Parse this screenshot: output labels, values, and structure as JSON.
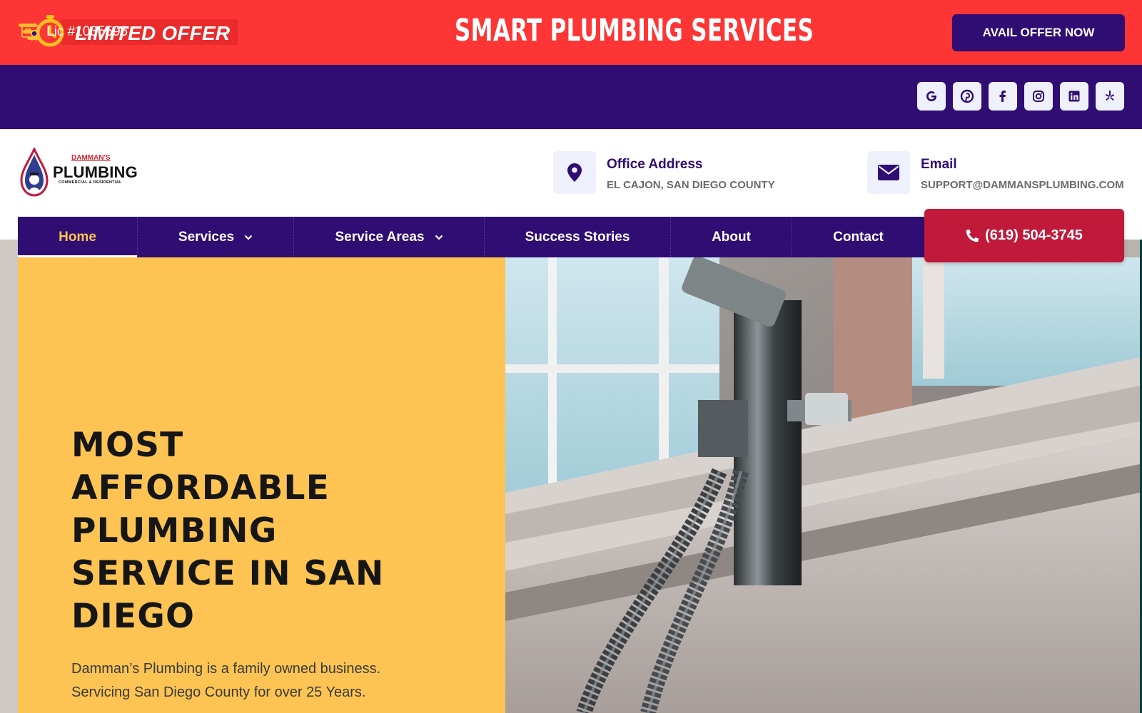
{
  "promo": {
    "badge_label": "LIMITED OFFER",
    "title": "SMART PLUMBING SERVICES",
    "cta_label": "AVAIL OFFER NOW",
    "background_color": "#fd3535"
  },
  "license_bar": {
    "license_text": "Lic #1035596",
    "social_icons": [
      "google-icon",
      "pinterest-icon",
      "facebook-icon",
      "instagram-icon",
      "linkedin-icon",
      "yelp-icon"
    ],
    "background_color": "#2f0d72"
  },
  "header": {
    "logo": {
      "top_text": "DAMMAN'S",
      "main_text": "PLUMBING",
      "sub_text": "COMMERCIAL & RESIDENTIAL"
    },
    "office": {
      "title": "Office Address",
      "value": "EL CAJON, SAN DIEGO COUNTY",
      "icon": "map-pin-icon"
    },
    "email": {
      "title": "Email",
      "value": "SUPPORT@DAMMANSPLUMBING.COM",
      "icon": "envelope-icon"
    }
  },
  "nav": {
    "items": [
      {
        "label": "Home",
        "active": true
      },
      {
        "label": "Services",
        "dropdown": true
      },
      {
        "label": "Service Areas",
        "dropdown": true
      },
      {
        "label": "Success Stories"
      },
      {
        "label": "About"
      },
      {
        "label": "Contact"
      }
    ],
    "phone": "(619) 504-3745",
    "phone_icon": "phone-icon",
    "accent_color": "#fdc453",
    "call_color": "#c0193a"
  },
  "hero": {
    "title_lines": [
      "MOST",
      "AFFORDABLE",
      "PLUMBING",
      "SERVICE IN SAN",
      "DIEGO"
    ],
    "text_lines": [
      "Damman’s Plumbing is a family owned business.",
      "Servicing San Diego County for over 25 Years."
    ],
    "panel_color": "#fdc453"
  }
}
